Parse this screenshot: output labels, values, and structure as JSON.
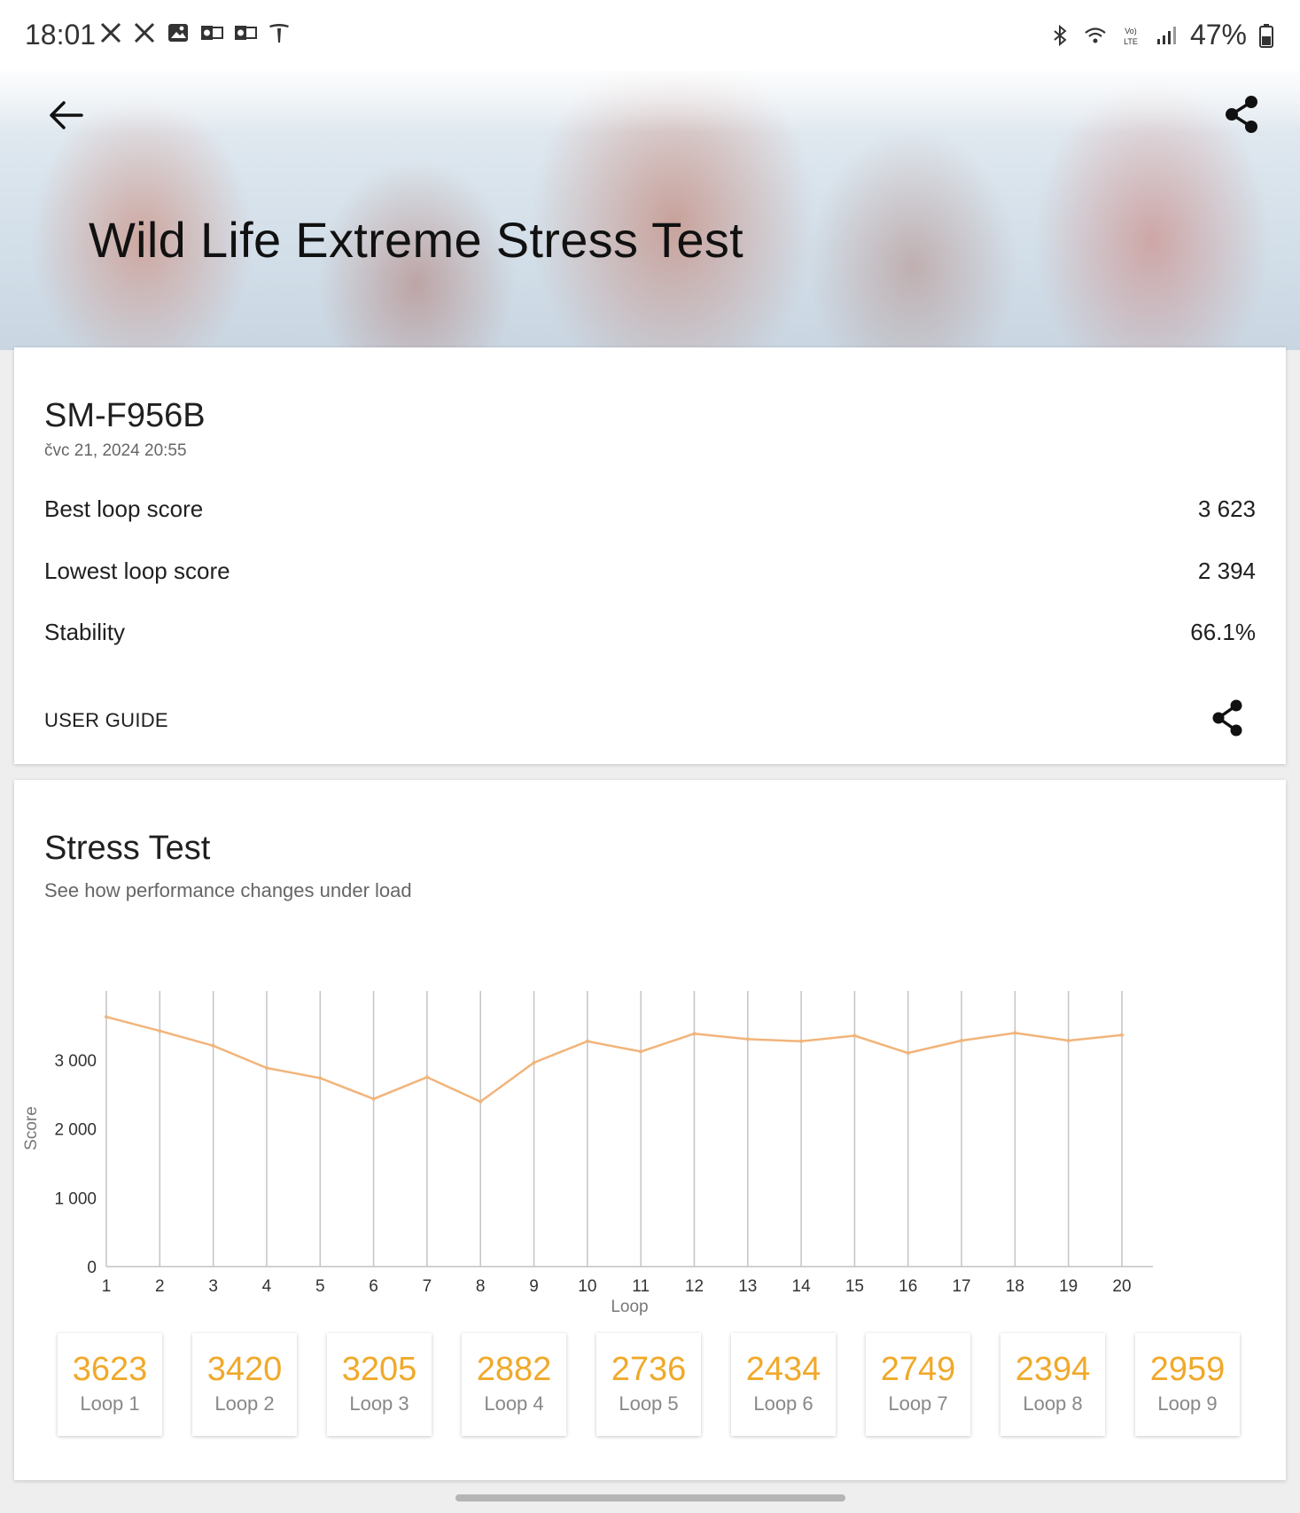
{
  "status_bar": {
    "time": "18:01",
    "battery_percent": "47%",
    "left_icons": [
      "x-icon",
      "x-icon",
      "image-icon",
      "outlook-icon",
      "outlook-icon",
      "tesla-icon"
    ],
    "right_icons": [
      "bluetooth-icon",
      "wifi-icon",
      "volte-icon",
      "signal-icon",
      "battery-icon"
    ]
  },
  "header": {
    "title": "Wild Life Extreme Stress Test",
    "back_icon": "arrow-left-icon",
    "share_icon": "share-icon"
  },
  "result": {
    "device": "SM-F956B",
    "date": "čvc 21, 2024 20:55",
    "rows": [
      {
        "label": "Best loop score",
        "value": "3 623"
      },
      {
        "label": "Lowest loop score",
        "value": "2 394"
      },
      {
        "label": "Stability",
        "value": "66.1%"
      }
    ],
    "user_guide": "USER GUIDE"
  },
  "stress": {
    "title": "Stress Test",
    "subtitle": "See how performance changes under load"
  },
  "chart_data": {
    "type": "line",
    "x": [
      1,
      2,
      3,
      4,
      5,
      6,
      7,
      8,
      9,
      10,
      11,
      12,
      13,
      14,
      15,
      16,
      17,
      18,
      19,
      20
    ],
    "x_ticks": [
      "1",
      "2",
      "3",
      "4",
      "5",
      "6",
      "7",
      "8",
      "9",
      "10",
      "11",
      "12",
      "13",
      "14",
      "15",
      "16",
      "17",
      "18",
      "19",
      "20"
    ],
    "y": [
      3623,
      3420,
      3205,
      2882,
      2736,
      2434,
      2749,
      2394,
      2959,
      3270,
      3120,
      3380,
      3300,
      3270,
      3350,
      3100,
      3280,
      3390,
      3280,
      3360
    ],
    "y_ticks": [
      {
        "value": 0,
        "label": "0"
      },
      {
        "value": 1000,
        "label": "1 000"
      },
      {
        "value": 2000,
        "label": "2 000"
      },
      {
        "value": 3000,
        "label": "3 000"
      }
    ],
    "ylim": [
      0,
      4000
    ],
    "xlabel": "Loop",
    "ylabel": "Score",
    "line_color": "#f2b47a",
    "grid": "vertical"
  },
  "loops": [
    {
      "value": "3623",
      "label": "Loop 1"
    },
    {
      "value": "3420",
      "label": "Loop 2"
    },
    {
      "value": "3205",
      "label": "Loop 3"
    },
    {
      "value": "2882",
      "label": "Loop 4"
    },
    {
      "value": "2736",
      "label": "Loop 5"
    },
    {
      "value": "2434",
      "label": "Loop 6"
    },
    {
      "value": "2749",
      "label": "Loop 7"
    },
    {
      "value": "2394",
      "label": "Loop 8"
    },
    {
      "value": "2959",
      "label": "Loop 9"
    }
  ],
  "colors": {
    "accent": "#f0a92a",
    "line": "#f2b47a",
    "text": "#202020",
    "muted": "#666666"
  }
}
